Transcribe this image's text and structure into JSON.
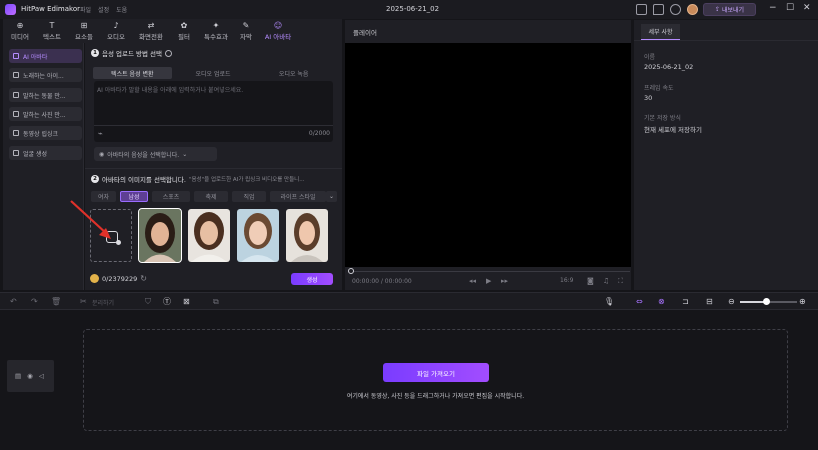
{
  "app": {
    "name": "HitPaw Edimakor",
    "menus": [
      "파일",
      "설정",
      "도움"
    ],
    "project_title": "2025-06-21_02",
    "export_label": "내보내기"
  },
  "toolbar": {
    "items": [
      {
        "label": "미디어",
        "icon": "media-icon"
      },
      {
        "label": "텍스트",
        "icon": "text-icon"
      },
      {
        "label": "요소들",
        "icon": "elements-icon"
      },
      {
        "label": "오디오",
        "icon": "audio-icon"
      },
      {
        "label": "화면전환",
        "icon": "transition-icon"
      },
      {
        "label": "필터",
        "icon": "filter-icon"
      },
      {
        "label": "특수효과",
        "icon": "effects-icon"
      },
      {
        "label": "자막",
        "icon": "subtitle-icon"
      },
      {
        "label": "AI 아바타",
        "icon": "ai-avatar-icon"
      }
    ],
    "active": "AI 아바타"
  },
  "sidebar": {
    "items": [
      {
        "label": "AI 아바타",
        "active": true
      },
      {
        "label": "노래하는 아이..."
      },
      {
        "label": "말하는 동물 만..."
      },
      {
        "label": "말하는 사진 만..."
      },
      {
        "label": "동영상 립싱크"
      },
      {
        "label": "얼굴 생성"
      }
    ]
  },
  "step1": {
    "num": "1",
    "title": "음성 업로드 방법 선택",
    "tabs": [
      "텍스트 음성 변환",
      "오디오 업로드",
      "오디오 녹음"
    ],
    "active_tab": "텍스트 음성 변환",
    "placeholder": "AI 아바타가 말할 내용을 아래에 입력하거나 붙여넣으세요.",
    "char_count": "0/2000",
    "voice_select": "아바타의 음성을 선택합니다."
  },
  "step2": {
    "num": "2",
    "title": "아바타의 이미지를 선택합니다.",
    "hint": "\"음성\"을 업로드한 AI가 립싱크 비디오를 만들니...",
    "tabs": [
      "여자",
      "남성",
      "스포츠",
      "축제",
      "직업",
      "라이프 스타일"
    ],
    "active_tab": "남성",
    "balance": "0/2379229",
    "generate_label": "생성"
  },
  "player": {
    "label": "플레이어",
    "timecode": "00:00:00 / 00:00:00",
    "ratio": "16:9"
  },
  "details": {
    "tab": "세부 사항",
    "fields": [
      {
        "label": "이름",
        "value": "2025-06-21_02"
      },
      {
        "label": "프레임 속도",
        "value": "30"
      },
      {
        "label": "기본 저장 방식",
        "value": "현재 세포에 저장하기"
      }
    ]
  },
  "timeline": {
    "split_label": "분리하기",
    "import_label": "파일 가져오기",
    "drop_hint": "여기에서 동영상, 사진 등을 드래그하거나 가져오면 편집을 시작합니다."
  },
  "colors": {
    "accent": "#a24dff",
    "background": "#151519",
    "panel": "#1f1f25"
  }
}
